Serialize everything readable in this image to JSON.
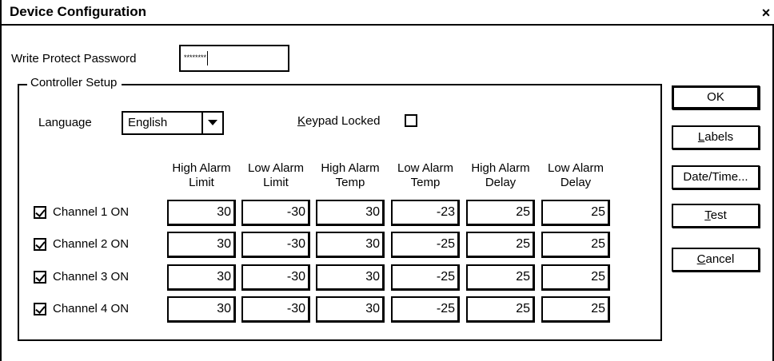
{
  "window": {
    "title": "Device Configuration",
    "close_label": "×"
  },
  "password": {
    "label": "Write Protect Password",
    "value": "********"
  },
  "group": {
    "title": "Controller Setup"
  },
  "language": {
    "label": "Language",
    "value": "English"
  },
  "keypad": {
    "label_pre": "",
    "label_accel": "K",
    "label_post": "eypad Locked",
    "checked": false
  },
  "columns": [
    {
      "line1": "High Alarm",
      "line2": "Limit"
    },
    {
      "line1": "Low Alarm",
      "line2": "Limit"
    },
    {
      "line1": "High Alarm",
      "line2": "Temp"
    },
    {
      "line1": "Low Alarm",
      "line2": "Temp"
    },
    {
      "line1": "High Alarm",
      "line2": "Delay"
    },
    {
      "line1": "Low Alarm",
      "line2": "Delay"
    }
  ],
  "channels": [
    {
      "label": "Channel 1 ON",
      "checked": true,
      "values": [
        "30",
        "-30",
        "30",
        "-23",
        "25",
        "25"
      ]
    },
    {
      "label": "Channel 2 ON",
      "checked": true,
      "values": [
        "30",
        "-30",
        "30",
        "-25",
        "25",
        "25"
      ]
    },
    {
      "label": "Channel 3 ON",
      "checked": true,
      "values": [
        "30",
        "-30",
        "30",
        "-25",
        "25",
        "25"
      ]
    },
    {
      "label": "Channel 4 ON",
      "checked": true,
      "values": [
        "30",
        "-30",
        "30",
        "-25",
        "25",
        "25"
      ]
    }
  ],
  "buttons": {
    "ok": {
      "pre": "",
      "accel": "",
      "post": "OK"
    },
    "labels": {
      "pre": "",
      "accel": "L",
      "post": "abels"
    },
    "datetime": {
      "pre": "",
      "accel": "",
      "post": "Date/Time..."
    },
    "test": {
      "pre": "",
      "accel": "T",
      "post": "est"
    },
    "cancel": {
      "pre": "",
      "accel": "C",
      "post": "ancel"
    }
  }
}
